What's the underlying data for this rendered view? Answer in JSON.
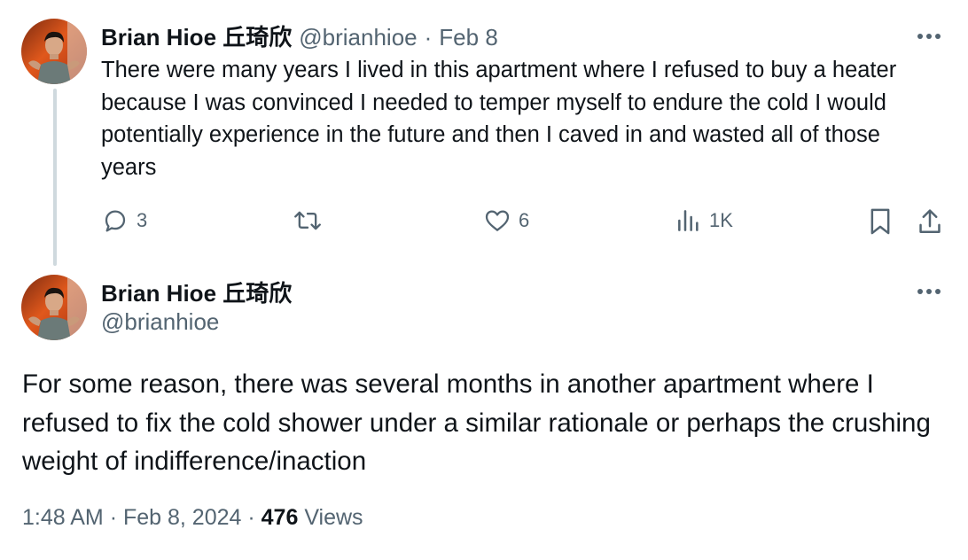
{
  "colors": {
    "text_primary": "#0f1419",
    "text_secondary": "#536471",
    "thread_line": "#cfd9de",
    "background": "#ffffff"
  },
  "tweet1": {
    "author_name": "Brian Hioe 丘琦欣",
    "handle": "@brianhioe",
    "separator": "·",
    "date": "Feb 8",
    "text": "There were many years I lived in this apartment where I refused to buy a heater because I was convinced I needed to temper myself to endure the cold I would potentially experience in the future and then I caved in and wasted all of those years",
    "actions": {
      "reply_icon": "reply-icon",
      "reply_count": "3",
      "retweet_icon": "retweet-icon",
      "retweet_count": "",
      "like_icon": "heart-icon",
      "like_count": "6",
      "views_icon": "analytics-icon",
      "views_count": "1K",
      "bookmark_icon": "bookmark-icon",
      "share_icon": "share-icon"
    },
    "more_icon": "more-icon"
  },
  "tweet2": {
    "author_name": "Brian Hioe 丘琦欣",
    "handle": "@brianhioe",
    "text": "For some reason, there was several months in another apartment where I refused to fix the cold shower under a similar rationale or perhaps the crushing weight of indifference/inaction",
    "time": "1:48 AM",
    "separator": "·",
    "date": "Feb 8, 2024",
    "views_count": "476",
    "views_label": "Views",
    "more_icon": "more-icon"
  }
}
